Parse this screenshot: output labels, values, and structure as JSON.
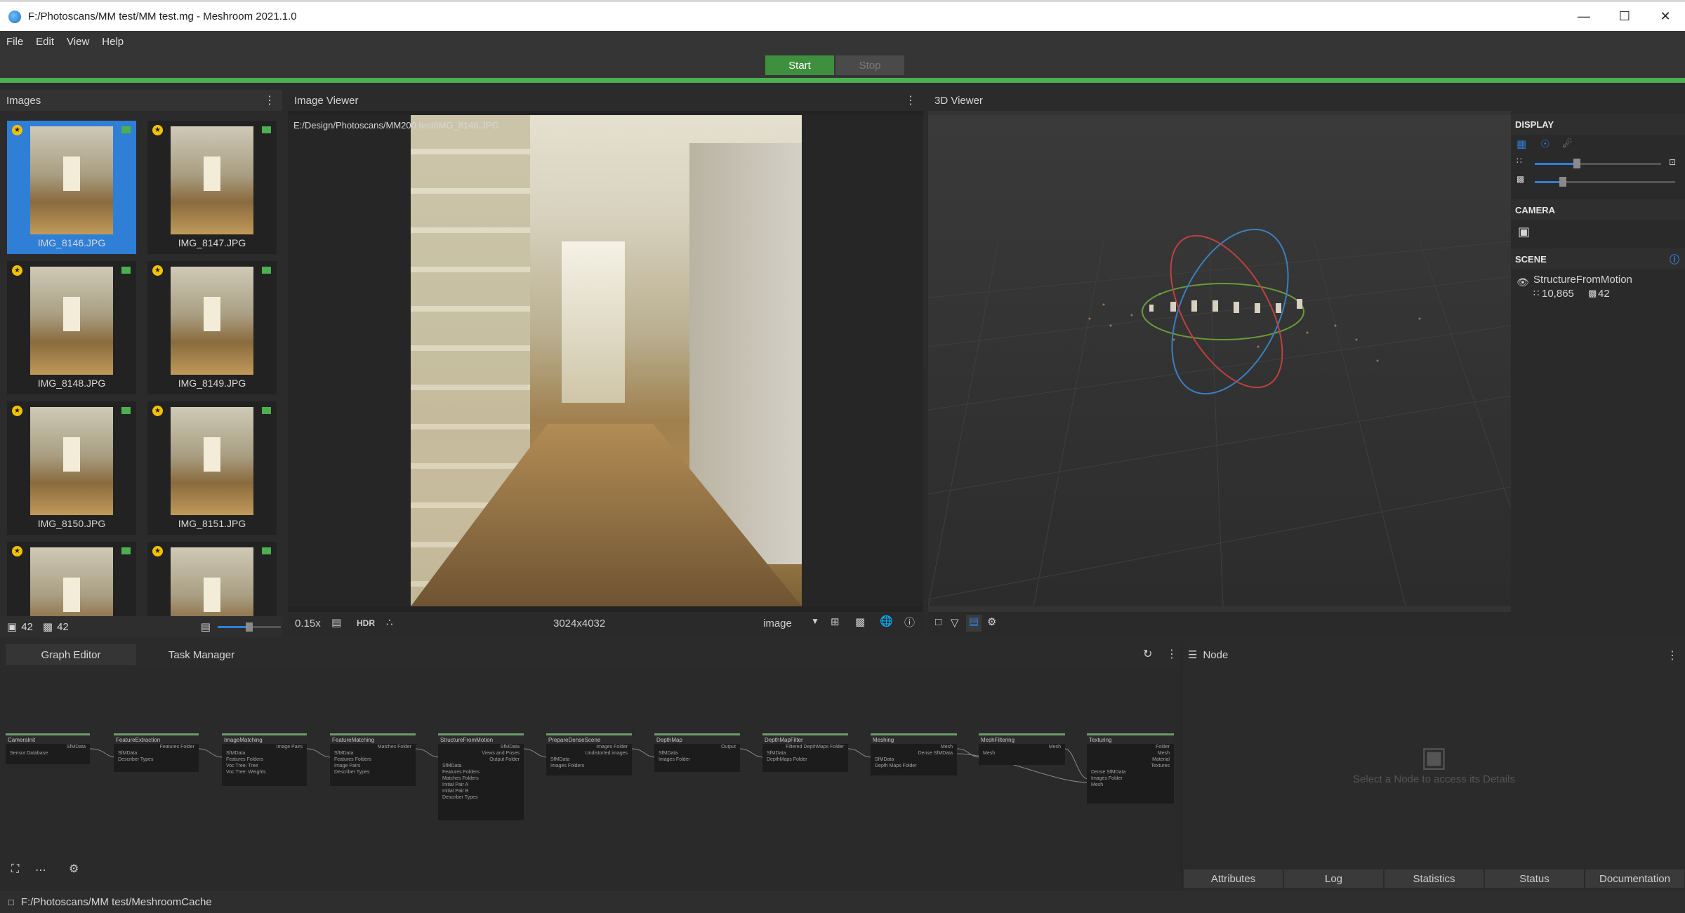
{
  "window": {
    "title": "F:/Photoscans/MM test/MM test.mg - Meshroom 2021.1.0"
  },
  "menu": [
    "File",
    "Edit",
    "View",
    "Help"
  ],
  "toolbar": {
    "start": "Start",
    "stop": "Stop"
  },
  "images_panel": {
    "title": "Images",
    "thumbnails": [
      {
        "label": "IMG_8146.JPG",
        "selected": true
      },
      {
        "label": "IMG_8147.JPG",
        "selected": false
      },
      {
        "label": "IMG_8148.JPG",
        "selected": false
      },
      {
        "label": "IMG_8149.JPG",
        "selected": false
      },
      {
        "label": "IMG_8150.JPG",
        "selected": false
      },
      {
        "label": "IMG_8151.JPG",
        "selected": false
      },
      {
        "label": "",
        "selected": false
      },
      {
        "label": "",
        "selected": false
      }
    ],
    "footer": {
      "image_count": "42",
      "camera_count": "42"
    }
  },
  "image_viewer": {
    "title": "Image Viewer",
    "path": "E:/Design/Photoscans/MM200 test/IMG_8146.JPG",
    "zoom": "0.15x",
    "hdr": "HDR",
    "resolution": "3024x4032",
    "mode": "image"
  },
  "viewer3d": {
    "title": "3D Viewer"
  },
  "scene_panel": {
    "display": "DISPLAY",
    "camera": "CAMERA",
    "scene": "SCENE",
    "item_name": "StructureFromMotion",
    "points": "10,865",
    "cameras": "42"
  },
  "bottom_tabs": [
    "Graph Editor",
    "Task Manager"
  ],
  "graph_nodes": [
    {
      "title": "CameraInit",
      "ports": [
        "Sensor Database",
        "SfMData"
      ]
    },
    {
      "title": "FeatureExtraction",
      "ports": [
        "SfMData",
        "Describer Types",
        "Features Folder"
      ]
    },
    {
      "title": "ImageMatching",
      "ports": [
        "SfMData",
        "Features Folders",
        "Voc Tree: Tree",
        "Voc Tree: Weights",
        "Image Pairs"
      ]
    },
    {
      "title": "FeatureMatching",
      "ports": [
        "SfMData",
        "Features Folders",
        "Image Pairs",
        "Describer Types",
        "Matches Folder"
      ]
    },
    {
      "title": "StructureFromMotion",
      "ports": [
        "SfMData",
        "Features Folders",
        "Matches Folders",
        "Initial Pair A",
        "Initial Pair B",
        "Describer Types",
        "Views and Poses",
        "Output Folder"
      ]
    },
    {
      "title": "PrepareDenseScene",
      "ports": [
        "SfMData",
        "Images Folders",
        "Images Folder",
        "Undistorted images"
      ]
    },
    {
      "title": "DepthMap",
      "ports": [
        "SfMData",
        "Images Folder",
        "Output"
      ]
    },
    {
      "title": "DepthMapFilter",
      "ports": [
        "SfMData",
        "DepthMaps Folder",
        "Filtered DepthMaps Folder"
      ]
    },
    {
      "title": "Meshing",
      "ports": [
        "SfMData",
        "Depth Maps Folder",
        "Mesh",
        "Dense SfMData"
      ]
    },
    {
      "title": "MeshFiltering",
      "ports": [
        "Mesh",
        "Mesh"
      ]
    },
    {
      "title": "Texturing",
      "ports": [
        "Dense SfMData",
        "Images Folder",
        "Mesh",
        "Folder",
        "Mesh",
        "Material",
        "Textures"
      ]
    }
  ],
  "node_panel": {
    "title": "Node",
    "placeholder": "Select a Node to access its Details",
    "tabs": [
      "Attributes",
      "Log",
      "Statistics",
      "Status",
      "Documentation"
    ]
  },
  "statusbar": {
    "path": "F:/Photoscans/MM test/MeshroomCache"
  },
  "colors": {
    "accent": "#4caf50",
    "selection": "#2f7fd6",
    "star": "#f2c200"
  }
}
